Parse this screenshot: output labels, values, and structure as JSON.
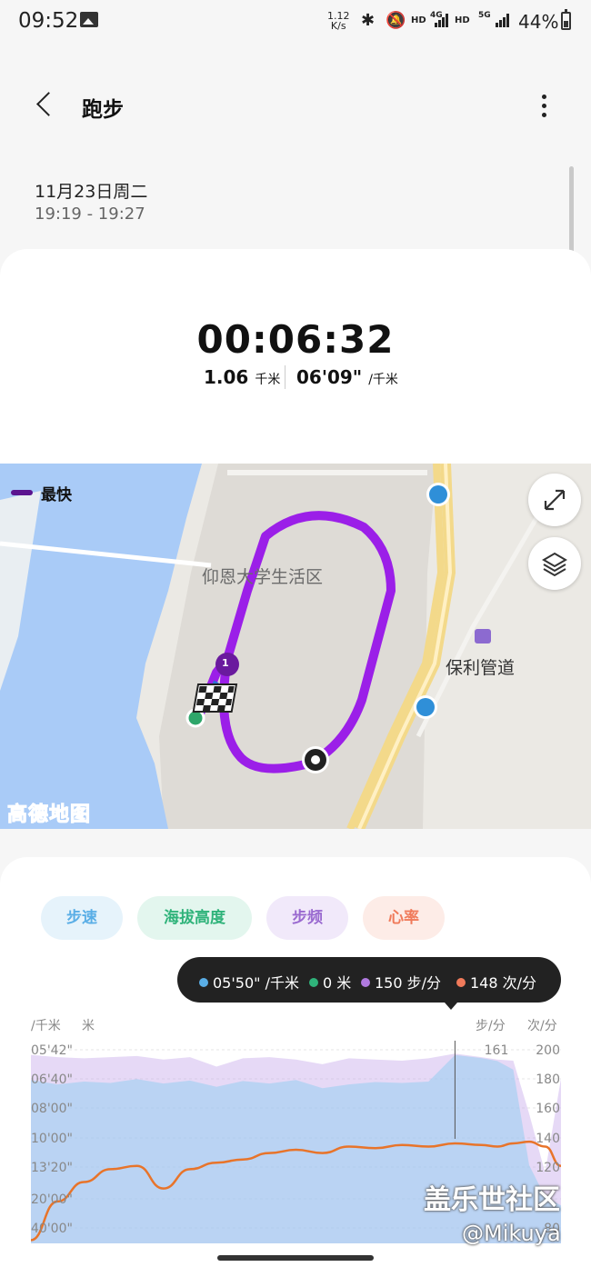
{
  "status_bar": {
    "time": "09:52",
    "net_speed_value": "1.12",
    "net_speed_unit": "K/s",
    "hd1": "HD",
    "net1": "4G",
    "hd2": "HD",
    "net2": "5G",
    "battery": "44%",
    "icons": [
      "image-icon",
      "bluetooth-icon",
      "mute-icon",
      "signal-icon",
      "battery-icon"
    ]
  },
  "header": {
    "title": "跑步"
  },
  "session": {
    "date": "11月23日周二",
    "time_range": "19:19 - 19:27"
  },
  "summary": {
    "duration": "00:06:32",
    "distance_value": "1.06",
    "distance_unit": "千米",
    "pace_value": "06'09\"",
    "pace_unit": "/千米"
  },
  "map": {
    "legend_label": "最快",
    "legend_color": "#5b148f",
    "route_color": "#9b1fe8",
    "place_labels": [
      "仰恩大学生活区",
      "保利管道"
    ],
    "brand": "高德地图",
    "marker_number": "1",
    "buttons": [
      "expand-icon",
      "layers-icon"
    ]
  },
  "metrics_tabs": [
    {
      "label": "步速",
      "color": "#5aaee6",
      "bg": "#e6f3fb"
    },
    {
      "label": "海拔高度",
      "color": "#2fb37a",
      "bg": "#e3f6ee"
    },
    {
      "label": "步频",
      "color": "#9a6ad0",
      "bg": "#f1e9fa"
    },
    {
      "label": "心率",
      "color": "#f07a5a",
      "bg": "#fdece7"
    }
  ],
  "tooltip": {
    "pace": "05'50\" /千米",
    "pace_color": "#5aaee6",
    "altitude": "0 米",
    "altitude_color": "#2fb37a",
    "cadence": "150 步/分",
    "cadence_color": "#b07adf",
    "heart_rate": "148 次/分",
    "heart_rate_color": "#f07a5a"
  },
  "chart_data": {
    "type": "area",
    "units": {
      "pace": "/千米",
      "altitude": "米",
      "cadence": "步/分",
      "heart_rate": "次/分"
    },
    "pace_ticks": [
      "05'42\"",
      "06'40\"",
      "08'00\"",
      "10'00\"",
      "13'20\"",
      "20'00\"",
      "40'00\""
    ],
    "cadence_ticks": [
      "161"
    ],
    "heart_rate_ticks": [
      "200",
      "180",
      "160",
      "140",
      "120",
      "80"
    ],
    "x": [
      0,
      5,
      10,
      15,
      20,
      25,
      30,
      35,
      40,
      45,
      50,
      55,
      60,
      65,
      70,
      75,
      80,
      85,
      88,
      91,
      94,
      97,
      100
    ],
    "series": [
      {
        "key": "pace",
        "values": [
          395,
          404,
          398,
          401,
          393,
          402,
          396,
          409,
          397,
          402,
          395,
          412,
          404,
          399,
          401,
          398,
          350,
          355,
          360,
          375,
          700,
          980,
          1100
        ]
      },
      {
        "key": "cadence",
        "values": [
          160,
          158,
          157,
          158,
          159,
          156,
          158,
          150,
          157,
          158,
          156,
          152,
          157,
          156,
          155,
          157,
          161,
          158,
          156,
          155,
          110,
          60,
          140
        ]
      },
      {
        "key": "heart_rate",
        "values": [
          82,
          106,
          118,
          126,
          128,
          114,
          126,
          130,
          132,
          136,
          138,
          136,
          140,
          139,
          141,
          140,
          142,
          141,
          140,
          142,
          143,
          140,
          128
        ]
      }
    ],
    "selected_index": 16
  },
  "watermark": {
    "text1": "盖乐世社区",
    "text2": "@Mikuya"
  }
}
